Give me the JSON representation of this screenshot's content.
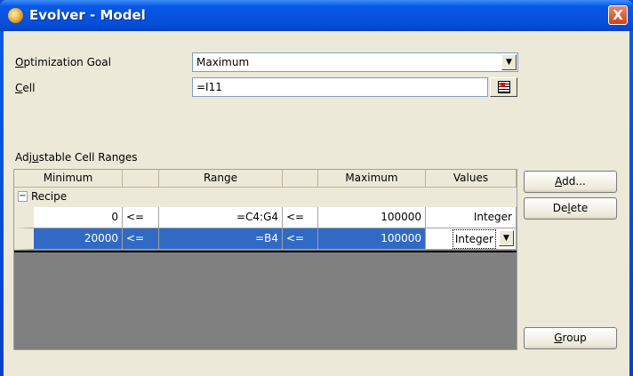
{
  "window": {
    "title": "Evolver - Model",
    "close": "X"
  },
  "goal": {
    "label_u": "O",
    "label_rest": "ptimization Goal",
    "value": "Maximum"
  },
  "cell": {
    "label_u": "C",
    "label_rest": "ell",
    "value": "=I11"
  },
  "ranges": {
    "label_pre": "Adj",
    "label_u": "u",
    "label_rest": "stable Cell Ranges",
    "headers": [
      "Minimum",
      "",
      "Range",
      "",
      "Maximum",
      "Values"
    ],
    "group": {
      "toggle": "−",
      "name": "Recipe"
    },
    "rows": [
      {
        "min": "0",
        "op1": "<=",
        "range": "=C4:G4",
        "op2": "<=",
        "max": "100000",
        "values": "Integer"
      },
      {
        "min": "20000",
        "op1": "<=",
        "range": "=B4",
        "op2": "<=",
        "max": "100000",
        "values": "Integer"
      }
    ]
  },
  "buttons": {
    "add_u": "A",
    "add_rest": "dd...",
    "delete_pre": "De",
    "delete_u": "l",
    "delete_rest": "ete",
    "group_u": "G",
    "group_rest": "roup"
  }
}
